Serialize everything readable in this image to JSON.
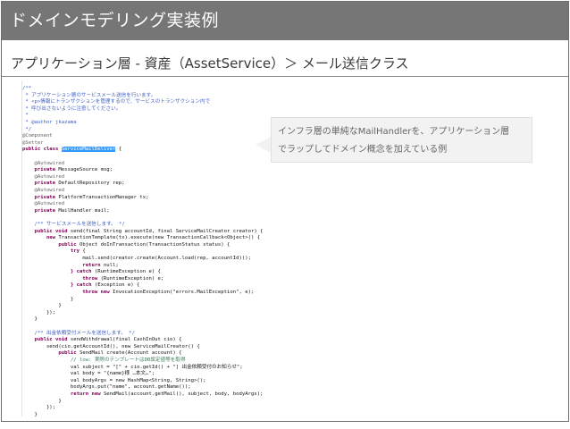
{
  "slide": {
    "title": "ドメインモデリング実装例",
    "subtitle": "アプリケーション層 - 資産（AssetService）＞ メール送信クラス",
    "callout_line1": "インフラ層の単純なMailHandlerを、アプリケーション層",
    "callout_line2": "でラップしてドメイン概念を加えている例"
  },
  "code": {
    "lines": [
      {
        "cls": "c-doc",
        "text": "/**"
      },
      {
        "cls": "c-doc",
        "text": " * アプリケーション層のサービスメール送信を行います。"
      },
      {
        "cls": "c-doc",
        "text": " * <p>情報にトランザクションを管理するので、サービスのトランザクション内で"
      },
      {
        "cls": "c-doc",
        "text": " * 呼び出さないように注意してください。"
      },
      {
        "cls": "c-doc",
        "text": " *"
      },
      {
        "cls": "c-doc",
        "text": " * @author jkazama"
      },
      {
        "cls": "c-doc",
        "text": " */"
      },
      {
        "cls": "c-ann",
        "text": "@Component"
      },
      {
        "cls": "c-ann",
        "text": "@Setter"
      },
      {
        "cls": "c-kw",
        "text": "public class ",
        "hl": "ServiceMailDeliver",
        "rest": " {"
      },
      {
        "cls": "",
        "text": ""
      },
      {
        "cls": "c-ann",
        "text": "    @Autowired"
      },
      {
        "cls": "c-kw",
        "text": "    private ",
        "rest": "MessageSource msg;"
      },
      {
        "cls": "c-ann",
        "text": "    @Autowired"
      },
      {
        "cls": "c-kw",
        "text": "    private ",
        "rest": "DefaultRepository rep;"
      },
      {
        "cls": "c-ann",
        "text": "    @Autowired"
      },
      {
        "cls": "c-kw",
        "text": "    private ",
        "rest": "PlatformTransactionManager tx;"
      },
      {
        "cls": "c-ann",
        "text": "    @Autowired"
      },
      {
        "cls": "c-kw",
        "text": "    private ",
        "rest": "MailHandler mail;"
      },
      {
        "cls": "",
        "text": ""
      },
      {
        "cls": "c-doc",
        "text": "    /** サービスメールを送信します。 */"
      },
      {
        "cls": "c-kw",
        "text": "    public void ",
        "rest": "send(final String accountId, final ServiceMailCreator creator) {"
      },
      {
        "cls": "c-kw",
        "text": "        new ",
        "rest": "TransactionTemplate(tx).execute(new TransactionCallback<Object>() {"
      },
      {
        "cls": "c-kw",
        "text": "            public ",
        "rest": "Object doInTransaction(TransactionStatus status) {"
      },
      {
        "cls": "c-kw",
        "text": "                try ",
        "rest": "{"
      },
      {
        "cls": "",
        "text": "                    mail.send(creator.create(Account.load(rep, accountId)));"
      },
      {
        "cls": "c-kw",
        "text": "                    return ",
        "rest": "null;"
      },
      {
        "cls": "c-kw",
        "text": "                } catch ",
        "rest": "(RuntimeException e) {"
      },
      {
        "cls": "c-kw",
        "text": "                    throw ",
        "rest": "(RuntimeException) e;"
      },
      {
        "cls": "c-kw",
        "text": "                } catch ",
        "rest": "(Exception e) {"
      },
      {
        "cls": "c-kw",
        "text": "                    throw new ",
        "rest": "InvocationException(\"errors.MailException\", e);"
      },
      {
        "cls": "",
        "text": "                }"
      },
      {
        "cls": "",
        "text": "            }"
      },
      {
        "cls": "",
        "text": "        });"
      },
      {
        "cls": "",
        "text": "    }"
      },
      {
        "cls": "",
        "text": ""
      },
      {
        "cls": "c-doc",
        "text": "    /** 出金依頼受付メールを送信します。 */"
      },
      {
        "cls": "c-kw",
        "text": "    public void ",
        "rest": "sendWithdrawal(final CashInOut cio) {"
      },
      {
        "cls": "",
        "text": "        send(cio.getAccountId(), new ServiceMailCreator() {"
      },
      {
        "cls": "c-kw",
        "text": "            public ",
        "rest": "SendMail create(Account account) {"
      },
      {
        "cls": "c-comment",
        "text": "                // low: 実際のテンプレートはDB設定値等を取得"
      },
      {
        "cls": "",
        "text": "                val subject = \"[\" + cio.getId() + \"] 出金依頼受付のお知らせ\";"
      },
      {
        "cls": "",
        "text": "                val body = \"{name}様 …本文…\";"
      },
      {
        "cls": "",
        "text": "                val bodyArgs = new HashMap<String, String>();"
      },
      {
        "cls": "",
        "text": "                bodyArgs.put(\"name\", account.getName());"
      },
      {
        "cls": "c-kw",
        "text": "                return new ",
        "rest": "SendMail(account.getMail(), subject, body, bodyArgs);"
      },
      {
        "cls": "",
        "text": "            }"
      },
      {
        "cls": "",
        "text": "        });"
      },
      {
        "cls": "",
        "text": "    }"
      }
    ]
  }
}
